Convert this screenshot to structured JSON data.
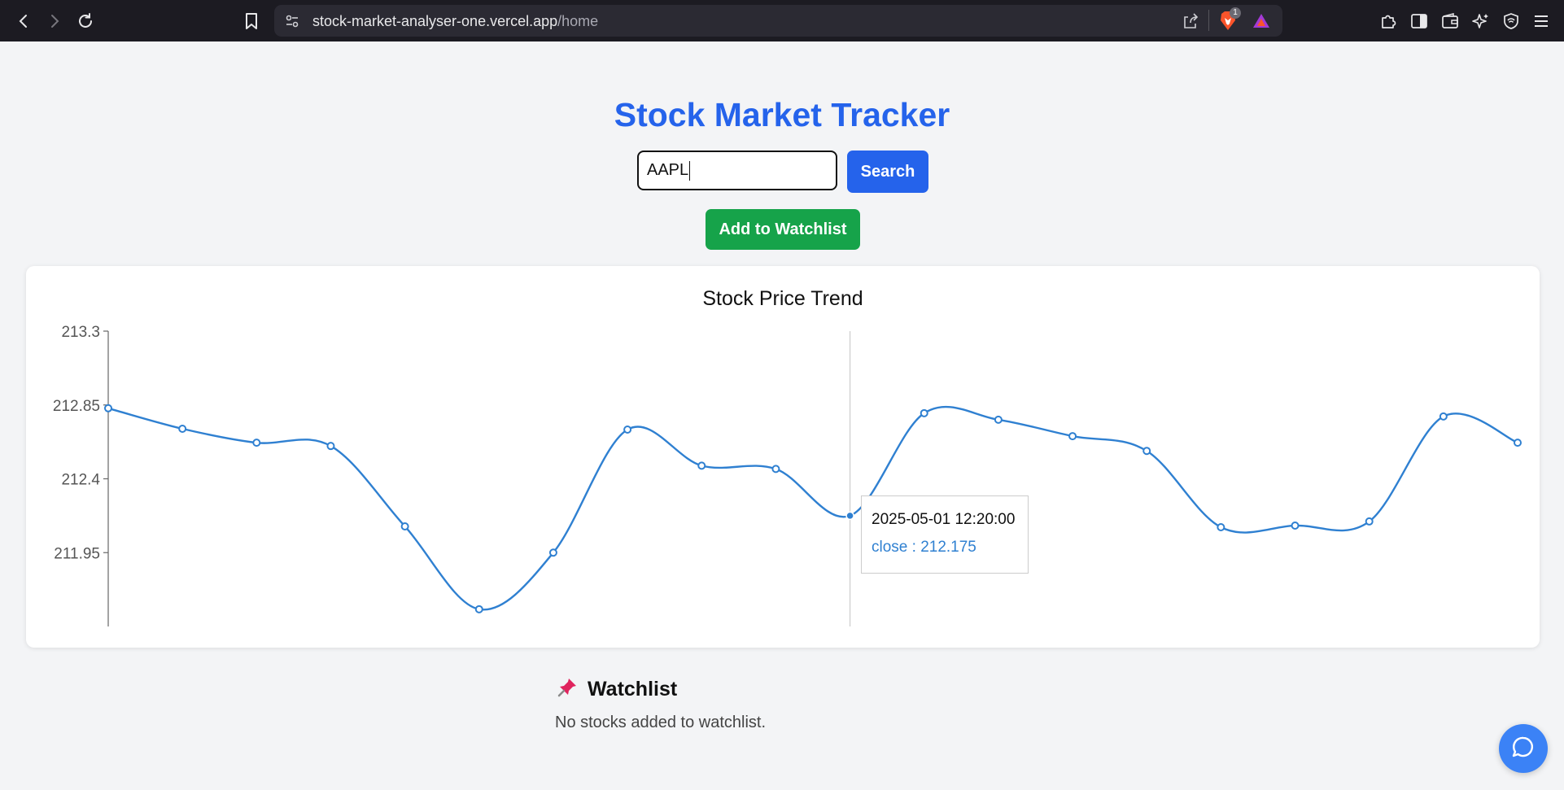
{
  "browser": {
    "url_domain": "stock-market-analyser-one.vercel.app",
    "url_path": "/home",
    "brave_badge": "1"
  },
  "header": {
    "title": "Stock Market Tracker"
  },
  "search": {
    "value": "AAPL",
    "button_label": "Search"
  },
  "watchlist_button": {
    "label": "Add to Watchlist"
  },
  "chart_data": {
    "type": "line",
    "title": "Stock Price Trend",
    "ylim": [
      211.5,
      213.3
    ],
    "yticks": [
      213.3,
      212.85,
      212.4,
      211.95
    ],
    "ytick_labels": [
      "213.3",
      "212.85",
      "212.4",
      "211.95"
    ],
    "series": [
      {
        "values": [
          212.83,
          212.705,
          212.62,
          212.6,
          212.11,
          211.605,
          211.95,
          212.7,
          212.48,
          212.46,
          212.175,
          212.8,
          212.76,
          212.66,
          212.57,
          212.105,
          212.115,
          212.14,
          212.78,
          212.62
        ],
        "color": "#2f80d1"
      }
    ],
    "grid": false,
    "active_index": 10
  },
  "tooltip": {
    "date": "2025-05-01 12:20:00",
    "value_text": "close : 212.175"
  },
  "watchlist": {
    "icon": "pin-icon",
    "title": "Watchlist",
    "empty_text": "No stocks added to watchlist."
  },
  "colors": {
    "title_blue": "#2563eb",
    "search_btn": "#2563eb",
    "watch_btn": "#16a34a",
    "line": "#2f80d1",
    "chat_btn": "#3b82f6"
  }
}
